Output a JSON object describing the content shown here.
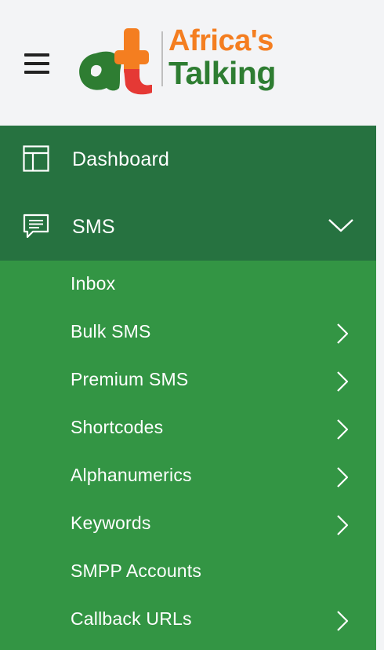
{
  "header": {
    "menu_icon": "hamburger-menu-icon",
    "logo": {
      "line1": "Africa's",
      "line2": "Talking",
      "mark_colors": {
        "green": "#2e7d32",
        "orange": "#f47e20",
        "red": "#e53935"
      }
    }
  },
  "sidebar": {
    "colors": {
      "top_bg": "#267240",
      "sub_bg": "#339544",
      "text": "#ffffff"
    },
    "items": [
      {
        "label": "Dashboard",
        "icon": "dashboard-layout-icon"
      },
      {
        "label": "SMS",
        "icon": "chat-bubble-icon",
        "expanded": true,
        "chevron": "chevron-down-icon"
      }
    ],
    "sms_submenu": [
      {
        "label": "Inbox",
        "has_children": false
      },
      {
        "label": "Bulk SMS",
        "has_children": true
      },
      {
        "label": "Premium SMS",
        "has_children": true
      },
      {
        "label": "Shortcodes",
        "has_children": true
      },
      {
        "label": "Alphanumerics",
        "has_children": true
      },
      {
        "label": "Keywords",
        "has_children": true
      },
      {
        "label": "SMPP Accounts",
        "has_children": false
      },
      {
        "label": "Callback URLs",
        "has_children": true
      }
    ]
  }
}
